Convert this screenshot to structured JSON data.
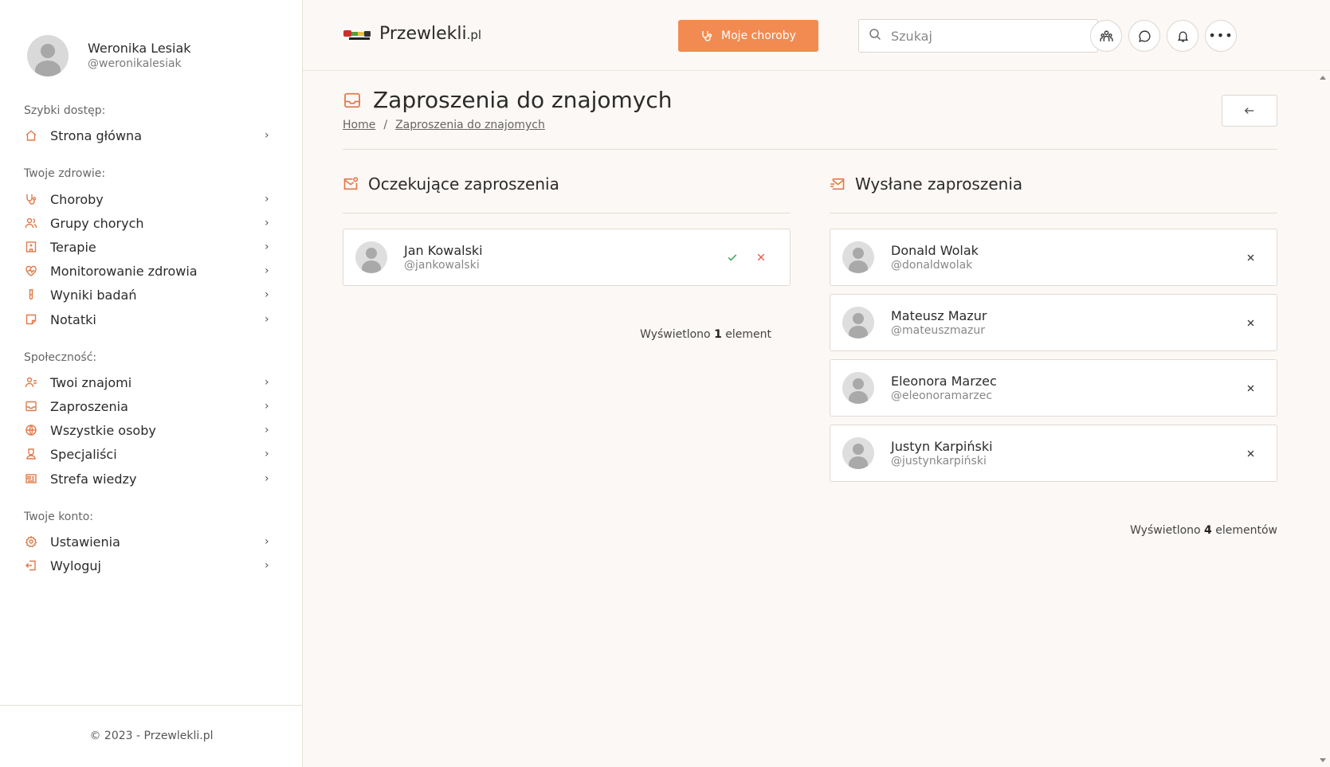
{
  "user": {
    "name": "Weronika Lesiak",
    "handle": "@weronikalesiak"
  },
  "sidebar": {
    "sections": [
      {
        "title": "Szybki dostęp:",
        "items": [
          {
            "label": "Strona główna",
            "icon": "home-icon"
          }
        ]
      },
      {
        "title": "Twoje zdrowie:",
        "items": [
          {
            "label": "Choroby",
            "icon": "stethoscope-icon"
          },
          {
            "label": "Grupy chorych",
            "icon": "users-icon"
          },
          {
            "label": "Terapie",
            "icon": "hospital-icon"
          },
          {
            "label": "Monitorowanie zdrowia",
            "icon": "heart-pulse-icon"
          },
          {
            "label": "Wyniki badań",
            "icon": "test-tube-icon"
          },
          {
            "label": "Notatki",
            "icon": "sticky-note-icon"
          }
        ]
      },
      {
        "title": "Społeczność:",
        "items": [
          {
            "label": "Twoi znajomi",
            "icon": "user-list-icon"
          },
          {
            "label": "Zaproszenia",
            "icon": "inbox-icon"
          },
          {
            "label": "Wszystkie osoby",
            "icon": "globe-icon"
          },
          {
            "label": "Specjaliści",
            "icon": "doctor-icon"
          },
          {
            "label": "Strefa wiedzy",
            "icon": "newspaper-icon"
          }
        ]
      },
      {
        "title": "Twoje konto:",
        "items": [
          {
            "label": "Ustawienia",
            "icon": "gear-icon"
          },
          {
            "label": "Wyloguj",
            "icon": "logout-icon"
          }
        ]
      }
    ],
    "footer": "© 2023 - Przewlekli.pl"
  },
  "header": {
    "logo": {
      "name": "Przewlekli",
      "suffix": ".pl"
    },
    "cta_label": "Moje choroby",
    "search_placeholder": "Szukaj",
    "icons": [
      "friends-icon",
      "chat-icon",
      "bell-icon",
      "more-icon"
    ]
  },
  "page": {
    "title": "Zaproszenia do znajomych",
    "breadcrumb": [
      "Home",
      "Zaproszenia do znajomych"
    ]
  },
  "pending": {
    "title": "Oczekujące zaproszenia",
    "items": [
      {
        "name": "Jan Kowalski",
        "handle": "@jankowalski"
      }
    ],
    "count_prefix": "Wyświetlono",
    "count": "1",
    "count_suffix": "element"
  },
  "sent": {
    "title": "Wysłane zaproszenia",
    "items": [
      {
        "name": "Donald Wolak",
        "handle": "@donaldwolak"
      },
      {
        "name": "Mateusz Mazur",
        "handle": "@mateuszmazur"
      },
      {
        "name": "Eleonora Marzec",
        "handle": "@eleonoramarzec"
      },
      {
        "name": "Justyn Karpiński",
        "handle": "@justynkarpiński"
      }
    ],
    "count_prefix": "Wyświetlono",
    "count": "4",
    "count_suffix": "elementów"
  },
  "colors": {
    "accent": "#f28b52",
    "icon": "#e07a4a",
    "background": "#fcf8f5",
    "accept": "#46a35a",
    "reject": "#e05a4a"
  }
}
